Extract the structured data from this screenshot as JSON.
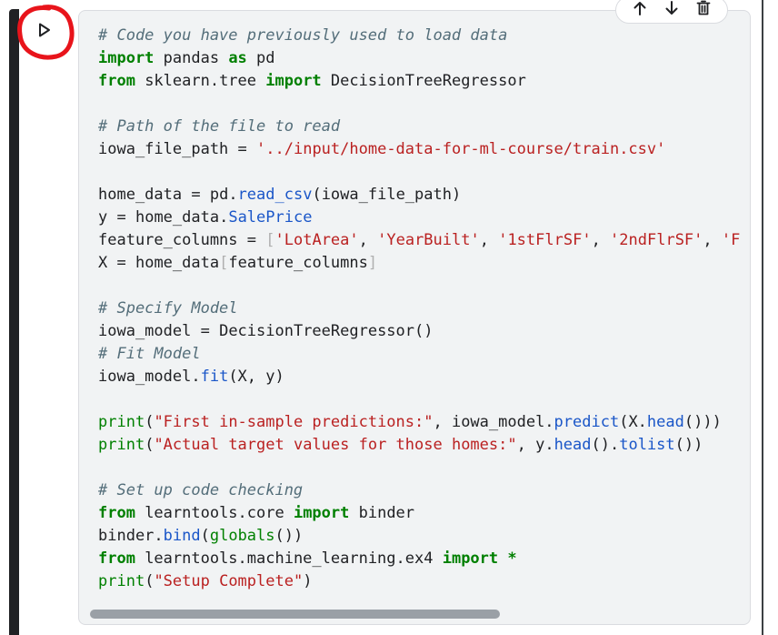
{
  "toolbar": {
    "move_up_icon": "arrow-up-icon",
    "move_down_icon": "arrow-down-icon",
    "delete_icon": "trash-icon"
  },
  "run_button": {
    "icon": "play-icon",
    "annotation": "red hand-drawn circle"
  },
  "colors": {
    "comment": "#546e7a",
    "keyword": "#008000",
    "string": "#ba2121",
    "attribute": "#1a56c8",
    "annotation": "#e8141b"
  },
  "code": {
    "lines": [
      [
        {
          "t": "comment",
          "v": "# Code you have previously used to load data"
        }
      ],
      [
        {
          "t": "keyword",
          "v": "import"
        },
        {
          "t": "plain",
          "v": " pandas "
        },
        {
          "t": "keyword",
          "v": "as"
        },
        {
          "t": "plain",
          "v": " pd"
        }
      ],
      [
        {
          "t": "keyword",
          "v": "from"
        },
        {
          "t": "plain",
          "v": " sklearn.tree "
        },
        {
          "t": "keyword",
          "v": "import"
        },
        {
          "t": "plain",
          "v": " DecisionTreeRegressor"
        }
      ],
      [],
      [
        {
          "t": "comment",
          "v": "# Path of the file to read"
        }
      ],
      [
        {
          "t": "plain",
          "v": "iowa_file_path "
        },
        {
          "t": "op",
          "v": "="
        },
        {
          "t": "plain",
          "v": " "
        },
        {
          "t": "string",
          "v": "'../input/home-data-for-ml-course/train.csv'"
        }
      ],
      [],
      [
        {
          "t": "plain",
          "v": "home_data "
        },
        {
          "t": "op",
          "v": "="
        },
        {
          "t": "plain",
          "v": " pd."
        },
        {
          "t": "attr",
          "v": "read_csv"
        },
        {
          "t": "plain",
          "v": "(iowa_file_path)"
        }
      ],
      [
        {
          "t": "plain",
          "v": "y "
        },
        {
          "t": "op",
          "v": "="
        },
        {
          "t": "plain",
          "v": " home_data."
        },
        {
          "t": "attr",
          "v": "SalePrice"
        }
      ],
      [
        {
          "t": "plain",
          "v": "feature_columns "
        },
        {
          "t": "op",
          "v": "="
        },
        {
          "t": "plain",
          "v": " "
        },
        {
          "t": "bracket",
          "v": "["
        },
        {
          "t": "string",
          "v": "'LotArea'"
        },
        {
          "t": "plain",
          "v": ", "
        },
        {
          "t": "string",
          "v": "'YearBuilt'"
        },
        {
          "t": "plain",
          "v": ", "
        },
        {
          "t": "string",
          "v": "'1stFlrSF'"
        },
        {
          "t": "plain",
          "v": ", "
        },
        {
          "t": "string",
          "v": "'2ndFlrSF'"
        },
        {
          "t": "plain",
          "v": ", "
        },
        {
          "t": "string",
          "v": "'F"
        }
      ],
      [
        {
          "t": "plain",
          "v": "X "
        },
        {
          "t": "op",
          "v": "="
        },
        {
          "t": "plain",
          "v": " home_data"
        },
        {
          "t": "bracket",
          "v": "["
        },
        {
          "t": "plain",
          "v": "feature_columns"
        },
        {
          "t": "bracket",
          "v": "]"
        }
      ],
      [],
      [
        {
          "t": "comment",
          "v": "# Specify Model"
        }
      ],
      [
        {
          "t": "plain",
          "v": "iowa_model "
        },
        {
          "t": "op",
          "v": "="
        },
        {
          "t": "plain",
          "v": " DecisionTreeRegressor()"
        }
      ],
      [
        {
          "t": "comment",
          "v": "# Fit Model"
        }
      ],
      [
        {
          "t": "plain",
          "v": "iowa_model."
        },
        {
          "t": "attr",
          "v": "fit"
        },
        {
          "t": "plain",
          "v": "(X, y)"
        }
      ],
      [],
      [
        {
          "t": "builtin",
          "v": "print"
        },
        {
          "t": "plain",
          "v": "("
        },
        {
          "t": "string",
          "v": "\"First in-sample predictions:\""
        },
        {
          "t": "plain",
          "v": ", iowa_model."
        },
        {
          "t": "attr",
          "v": "predict"
        },
        {
          "t": "plain",
          "v": "(X."
        },
        {
          "t": "attr",
          "v": "head"
        },
        {
          "t": "plain",
          "v": "()))"
        }
      ],
      [
        {
          "t": "builtin",
          "v": "print"
        },
        {
          "t": "plain",
          "v": "("
        },
        {
          "t": "string",
          "v": "\"Actual target values for those homes:\""
        },
        {
          "t": "plain",
          "v": ", y."
        },
        {
          "t": "attr",
          "v": "head"
        },
        {
          "t": "plain",
          "v": "()."
        },
        {
          "t": "attr",
          "v": "tolist"
        },
        {
          "t": "plain",
          "v": "())"
        }
      ],
      [],
      [
        {
          "t": "comment",
          "v": "# Set up code checking"
        }
      ],
      [
        {
          "t": "keyword",
          "v": "from"
        },
        {
          "t": "plain",
          "v": " learntools.core "
        },
        {
          "t": "keyword",
          "v": "import"
        },
        {
          "t": "plain",
          "v": " binder"
        }
      ],
      [
        {
          "t": "plain",
          "v": "binder."
        },
        {
          "t": "attr",
          "v": "bind"
        },
        {
          "t": "plain",
          "v": "("
        },
        {
          "t": "builtin",
          "v": "globals"
        },
        {
          "t": "plain",
          "v": "())"
        }
      ],
      [
        {
          "t": "keyword",
          "v": "from"
        },
        {
          "t": "plain",
          "v": " learntools.machine_learning.ex4 "
        },
        {
          "t": "keyword",
          "v": "import"
        },
        {
          "t": "plain",
          "v": " "
        },
        {
          "t": "keyword",
          "v": "*"
        }
      ],
      [
        {
          "t": "builtin",
          "v": "print"
        },
        {
          "t": "plain",
          "v": "("
        },
        {
          "t": "string",
          "v": "\"Setup Complete\""
        },
        {
          "t": "plain",
          "v": ")"
        }
      ]
    ]
  },
  "scrollbar": {
    "visible_fraction": 0.63,
    "position_fraction": 0.0
  }
}
